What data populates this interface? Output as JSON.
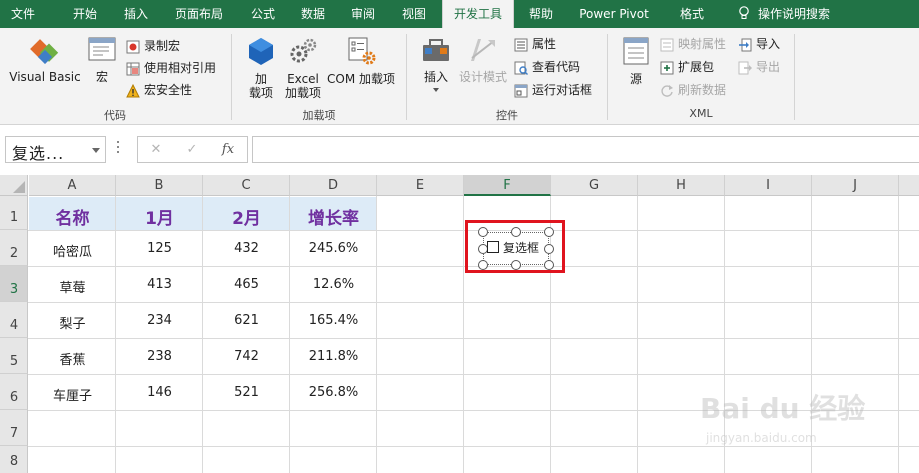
{
  "tabs": [
    {
      "label": "文件",
      "active": false
    },
    {
      "label": "开始",
      "active": false
    },
    {
      "label": "插入",
      "active": false
    },
    {
      "label": "页面布局",
      "active": false
    },
    {
      "label": "公式",
      "active": false
    },
    {
      "label": "数据",
      "active": false
    },
    {
      "label": "审阅",
      "active": false
    },
    {
      "label": "视图",
      "active": false
    },
    {
      "label": "开发工具",
      "active": true
    },
    {
      "label": "帮助",
      "active": false
    },
    {
      "label": "Power Pivot",
      "active": false
    },
    {
      "label": "格式",
      "active": false
    }
  ],
  "search": {
    "label": "操作说明搜索",
    "icon": "lightbulb-icon"
  },
  "ribbon": {
    "code": {
      "label": "代码",
      "visual_basic": "Visual Basic",
      "macros": "宏",
      "record_macro": "录制宏",
      "relative_ref": "使用相对引用",
      "macro_security": "宏安全性"
    },
    "addins": {
      "label": "加载项",
      "addins_line1": "加",
      "addins_line2": "载项",
      "excel_line1": "Excel",
      "excel_line2": "加载项",
      "com": "COM 加载项"
    },
    "controls": {
      "label": "控件",
      "insert": "插入",
      "design_mode": "设计模式",
      "properties": "属性",
      "view_code": "查看代码",
      "run_dialog": "运行对话框"
    },
    "xml": {
      "label": "XML",
      "source": "源",
      "map_properties": "映射属性",
      "expansion_packs": "扩展包",
      "refresh_data": "刷新数据",
      "import": "导入",
      "export": "导出"
    }
  },
  "formula_bar": {
    "name_box": "复选...",
    "cancel_icon": "✕",
    "enter_icon": "✓",
    "fx_label": "fx",
    "formula": ""
  },
  "grid": {
    "columns": [
      "A",
      "B",
      "C",
      "D",
      "E",
      "F",
      "G",
      "H",
      "I",
      "J"
    ],
    "rows": [
      "1",
      "2",
      "3",
      "4",
      "5",
      "6",
      "7",
      "8"
    ],
    "header": [
      "名称",
      "1月",
      "2月",
      "增长率"
    ],
    "data": [
      [
        "哈密瓜",
        "125",
        "432",
        "245.6%"
      ],
      [
        "草莓",
        "413",
        "465",
        "12.6%"
      ],
      [
        "梨子",
        "234",
        "621",
        "165.4%"
      ],
      [
        "香蕉",
        "238",
        "742",
        "211.8%"
      ],
      [
        "车厘子",
        "146",
        "521",
        "256.8%"
      ]
    ],
    "selected_column": "F",
    "selected_row": "3"
  },
  "checkbox": {
    "label": "复选框",
    "checked": false
  },
  "watermark": {
    "text": "Bai du 经验",
    "sub": "jingyan.baidu.com"
  },
  "colors": {
    "excel_green": "#217346",
    "header_fill": "#ddebf7",
    "header_text": "#7030a0",
    "highlight_red": "#e0141e"
  }
}
